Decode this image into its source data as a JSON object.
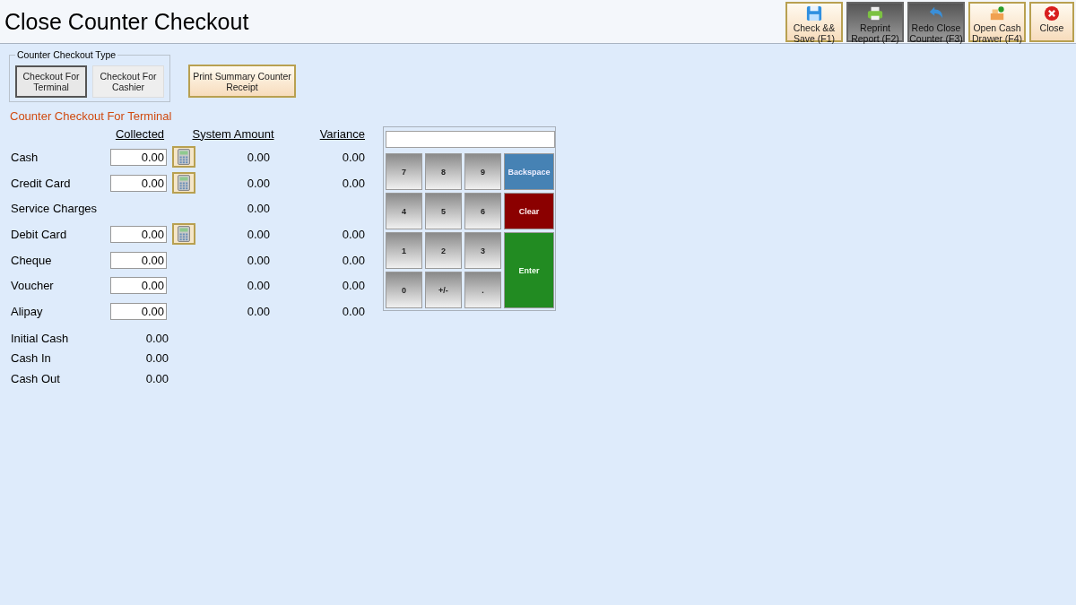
{
  "window": {
    "title": "Close Counter Checkout"
  },
  "toolbar": [
    {
      "kind": "save",
      "label": "Check && Save (F1)",
      "disabled": false
    },
    {
      "kind": "print",
      "label": "Reprint Report (F2)",
      "disabled": true
    },
    {
      "kind": "undo",
      "label": "Redo Close Counter (F3)",
      "disabled": true
    },
    {
      "kind": "drawer",
      "label": "Open Cash Drawer (F4)",
      "disabled": false
    },
    {
      "kind": "close",
      "label": "Close",
      "disabled": false
    }
  ],
  "checkout_type": {
    "legend": "Counter Checkout Type",
    "options": [
      {
        "label": "Checkout For Terminal",
        "selected": true
      },
      {
        "label": "Checkout For Cashier",
        "selected": false
      }
    ]
  },
  "print_button": "Print Summary Counter Receipt",
  "section_title": "Counter Checkout For Terminal",
  "columns": [
    "Collected",
    "System Amount",
    "Variance"
  ],
  "rows": [
    {
      "name": "Cash",
      "collected": "0.00",
      "calculator": true,
      "system": "0.00",
      "variance": "0.00"
    },
    {
      "name": "Credit Card",
      "collected": "0.00",
      "calculator": true,
      "system": "0.00",
      "variance": "0.00"
    },
    {
      "name": "Service Charges",
      "system": "0.00"
    },
    {
      "name": "Debit Card",
      "collected": "0.00",
      "calculator": true,
      "system": "0.00",
      "variance": "0.00"
    },
    {
      "name": "Cheque",
      "collected": "0.00",
      "calculator": false,
      "system": "0.00",
      "variance": "0.00"
    },
    {
      "name": "Voucher",
      "collected": "0.00",
      "calculator": false,
      "system": "0.00",
      "variance": "0.00"
    },
    {
      "name": "Alipay",
      "collected": "0.00",
      "calculator": false,
      "system": "0.00",
      "variance": "0.00"
    }
  ],
  "totals": [
    {
      "name": "Initial Cash",
      "value": "0.00"
    },
    {
      "name": "Cash In",
      "value": "0.00"
    },
    {
      "name": "Cash Out",
      "value": "0.00"
    }
  ],
  "keypad": {
    "keys": [
      {
        "kind": "digit",
        "label": "7"
      },
      {
        "kind": "digit",
        "label": "8"
      },
      {
        "kind": "digit",
        "label": "9"
      },
      {
        "kind": "backspace",
        "label": "Backspace"
      },
      {
        "kind": "digit",
        "label": "4"
      },
      {
        "kind": "digit",
        "label": "5"
      },
      {
        "kind": "digit",
        "label": "6"
      },
      {
        "kind": "clear",
        "label": "Clear"
      },
      {
        "kind": "digit",
        "label": "1"
      },
      {
        "kind": "digit",
        "label": "2"
      },
      {
        "kind": "digit",
        "label": "3"
      },
      {
        "kind": "enter",
        "label": "Enter"
      },
      {
        "kind": "digit",
        "label": "0"
      },
      {
        "kind": "digit",
        "label": "+/-"
      },
      {
        "kind": "digit",
        "label": "."
      }
    ]
  }
}
